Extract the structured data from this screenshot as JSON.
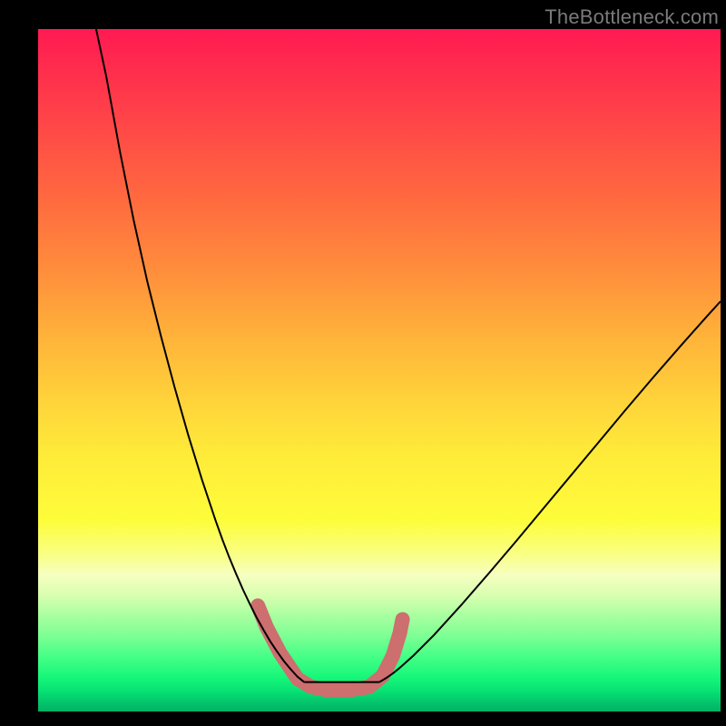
{
  "watermark": "TheBottleneck.com",
  "chart_data": {
    "type": "line",
    "title": "",
    "xlabel": "",
    "ylabel": "",
    "xlim": [
      0,
      100
    ],
    "ylim": [
      0,
      100
    ],
    "grid": false,
    "legend": false,
    "background_gradient": {
      "top": "#ff1a52",
      "mid": "#fff53a",
      "bottom": "#02b265"
    },
    "series": [
      {
        "name": "curve-left",
        "color": "#000000",
        "stroke_width": 2,
        "x": [
          8.5,
          10,
          12,
          14,
          16,
          18,
          20,
          22,
          24,
          26,
          27,
          28,
          29,
          30,
          31,
          32,
          33,
          34,
          35,
          36,
          37,
          38,
          38.5,
          39
        ],
        "y": [
          100,
          93,
          82,
          72,
          63,
          55,
          47.5,
          40.5,
          34,
          28,
          25.2,
          22.6,
          20.2,
          17.9,
          15.8,
          13.8,
          12,
          10.3,
          8.8,
          7.4,
          6.2,
          5.1,
          4.7,
          4.3
        ]
      },
      {
        "name": "curve-right",
        "color": "#000000",
        "stroke_width": 2,
        "x": [
          50,
          51,
          52,
          53,
          55,
          58,
          62,
          66,
          70,
          74,
          78,
          82,
          86,
          90,
          94,
          98,
          100
        ],
        "y": [
          4.3,
          4.9,
          5.6,
          6.4,
          8.2,
          11.2,
          15.6,
          20.2,
          24.9,
          29.7,
          34.5,
          39.3,
          44.1,
          48.8,
          53.4,
          57.9,
          60.1
        ]
      },
      {
        "name": "floor-segment",
        "color": "#000000",
        "stroke_width": 2,
        "x": [
          39,
          50
        ],
        "y": [
          4.3,
          4.3
        ]
      },
      {
        "name": "marker-band",
        "color": "#cd6e6f",
        "stroke_width": 16,
        "linecap": "round",
        "x": [
          32.2,
          33.5,
          35.5,
          38,
          40,
          42,
          44,
          46,
          48.5,
          50.5,
          52,
          53,
          53.4
        ],
        "y": [
          15.5,
          12.3,
          8.5,
          4.8,
          3.6,
          3.2,
          3.2,
          3.2,
          3.6,
          5.2,
          8.2,
          11.5,
          13.5
        ]
      }
    ]
  }
}
